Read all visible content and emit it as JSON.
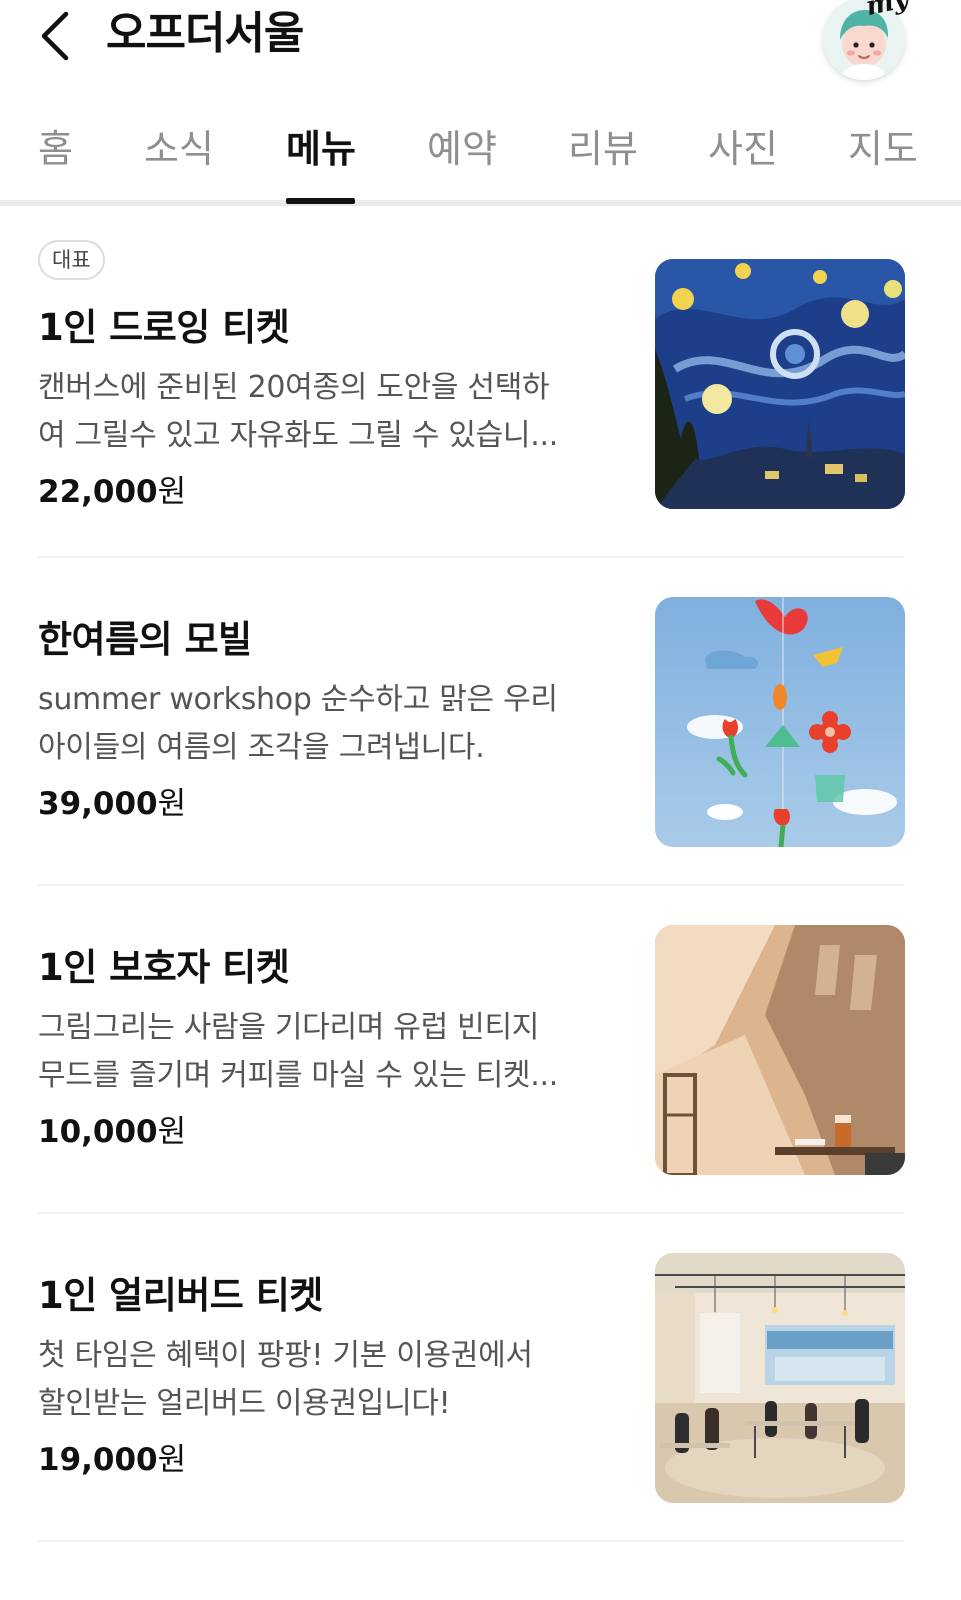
{
  "header": {
    "title": "오프더서울",
    "avatar_tag": "my",
    "back_icon": "chevron-left-icon"
  },
  "tabs": [
    {
      "label": "홈",
      "active": false
    },
    {
      "label": "소식",
      "active": false
    },
    {
      "label": "메뉴",
      "active": true
    },
    {
      "label": "예약",
      "active": false
    },
    {
      "label": "리뷰",
      "active": false
    },
    {
      "label": "사진",
      "active": false
    },
    {
      "label": "지도",
      "active": false
    }
  ],
  "menu_items": [
    {
      "badge": "대표",
      "name": "1인 드로잉 티켓",
      "desc_line1": "캔버스에 준비된 20여종의 도안을 선택하",
      "desc_line2": "여 그릴수 있고 자유화도 그릴 수 있습니...",
      "price_number": "22,000",
      "price_unit": "원"
    },
    {
      "name": "한여름의 모빌",
      "desc_line1": "summer workshop 순수하고 맑은 우리",
      "desc_line2": "아이들의 여름의 조각을 그려냅니다.",
      "price_number": "39,000",
      "price_unit": "원"
    },
    {
      "name": "1인 보호자 티켓",
      "desc_line1": "그림그리는 사람을 기다리며 유럽 빈티지",
      "desc_line2": "무드를 즐기며 커피를 마실 수 있는 티켓...",
      "price_number": "10,000",
      "price_unit": "원"
    },
    {
      "name": "1인 얼리버드 티켓",
      "desc_line1": "첫 타임은 혜택이 팡팡! 기본 이용권에서",
      "desc_line2": "할인받는 얼리버드 이용권입니다!",
      "price_number": "19,000",
      "price_unit": "원"
    }
  ],
  "colors": {
    "active_tab": "#111111",
    "inactive_tab": "#8e8e93",
    "divider": "#ebebef"
  }
}
